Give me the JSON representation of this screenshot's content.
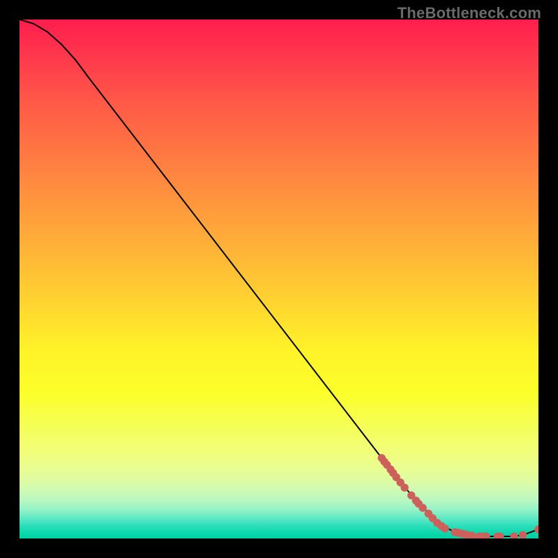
{
  "watermark": "TheBottleneck.com",
  "chart_data": {
    "type": "line",
    "title": "",
    "xlabel": "",
    "ylabel": "",
    "xlim": [
      0,
      100
    ],
    "ylim": [
      0,
      100
    ],
    "grid": false,
    "legend": false,
    "series": [
      {
        "name": "curve",
        "x": [
          0.0,
          2.7,
          5.4,
          8.1,
          10.8,
          13.4,
          73.8,
          80.5,
          83.9,
          87.2,
          89.9,
          92.6,
          95.3,
          97.0,
          100.0
        ],
        "y": [
          100.0,
          99.2,
          97.6,
          95.2,
          92.2,
          88.7,
          10.3,
          3.0,
          1.2,
          0.54,
          0.4,
          0.4,
          0.4,
          0.67,
          1.75
        ]
      }
    ],
    "clusters": [
      {
        "name": "dots-diagonal",
        "color": "#cb615a",
        "points": [
          {
            "x": 69.8,
            "y": 15.5
          },
          {
            "x": 70.3,
            "y": 14.8
          },
          {
            "x": 70.8,
            "y": 14.2
          },
          {
            "x": 71.5,
            "y": 13.3
          },
          {
            "x": 72.0,
            "y": 12.6
          },
          {
            "x": 72.6,
            "y": 11.8
          },
          {
            "x": 73.4,
            "y": 10.8
          },
          {
            "x": 74.2,
            "y": 9.8
          },
          {
            "x": 75.5,
            "y": 8.3
          },
          {
            "x": 76.4,
            "y": 7.3
          },
          {
            "x": 76.9,
            "y": 6.7
          },
          {
            "x": 77.7,
            "y": 5.9
          },
          {
            "x": 78.8,
            "y": 4.8
          },
          {
            "x": 79.6,
            "y": 3.9
          },
          {
            "x": 80.5,
            "y": 3.0
          },
          {
            "x": 81.3,
            "y": 2.4
          },
          {
            "x": 82.0,
            "y": 1.9
          }
        ]
      },
      {
        "name": "dots-floor",
        "color": "#cb615a",
        "points": [
          {
            "x": 83.9,
            "y": 1.21
          },
          {
            "x": 84.6,
            "y": 1.08
          },
          {
            "x": 85.2,
            "y": 0.94
          },
          {
            "x": 85.8,
            "y": 0.81
          },
          {
            "x": 86.4,
            "y": 0.67
          },
          {
            "x": 87.2,
            "y": 0.54
          },
          {
            "x": 88.6,
            "y": 0.4
          },
          {
            "x": 89.2,
            "y": 0.4
          },
          {
            "x": 89.9,
            "y": 0.4
          },
          {
            "x": 92.1,
            "y": 0.4
          },
          {
            "x": 92.6,
            "y": 0.4
          },
          {
            "x": 95.3,
            "y": 0.4
          },
          {
            "x": 97.0,
            "y": 0.67
          },
          {
            "x": 100.0,
            "y": 1.75
          }
        ]
      }
    ]
  }
}
